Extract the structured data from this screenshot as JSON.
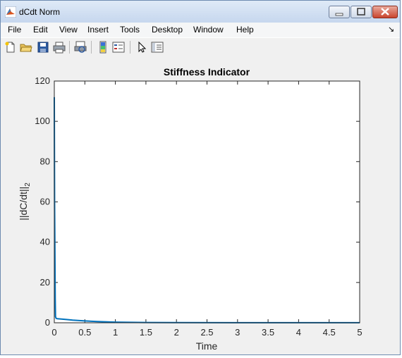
{
  "window": {
    "title": "dCdt Norm"
  },
  "menu": {
    "items": [
      "File",
      "Edit",
      "View",
      "Insert",
      "Tools",
      "Desktop",
      "Window",
      "Help"
    ]
  },
  "toolbar": {
    "icons": [
      "new-figure-icon",
      "open-icon",
      "save-icon",
      "print-icon",
      "print-preview-icon",
      "colorbar-icon",
      "legend-icon",
      "pointer-icon",
      "property-editor-icon"
    ]
  },
  "colors": {
    "line": "#0072bd",
    "axes": "#262626",
    "figure_bg": "#f0f0f0"
  },
  "chart_data": {
    "type": "line",
    "title": "Stiffness Indicator",
    "xlabel": "Time",
    "ylabel_main": "||dC/dt||",
    "ylabel_subscript": "2",
    "xlim": [
      0,
      5
    ],
    "ylim": [
      0,
      120
    ],
    "xticks": [
      "0",
      "0.5",
      "1",
      "1.5",
      "2",
      "2.5",
      "3",
      "3.5",
      "4",
      "4.5",
      "5"
    ],
    "yticks": [
      "0",
      "20",
      "40",
      "60",
      "80",
      "100",
      "120"
    ],
    "grid": false,
    "series": [
      {
        "x": [
          0,
          0.005,
          0.01,
          0.015,
          0.02,
          0.03,
          0.05,
          0.1,
          0.2,
          0.3,
          0.5,
          0.7,
          1.0,
          1.5,
          2.0,
          3.0,
          4.0,
          5.0
        ],
        "y": [
          112,
          60,
          33,
          12,
          3,
          2.2,
          2.0,
          1.9,
          1.6,
          1.3,
          0.9,
          0.6,
          0.3,
          0.15,
          0.1,
          0.05,
          0.03,
          0.02
        ]
      }
    ]
  }
}
